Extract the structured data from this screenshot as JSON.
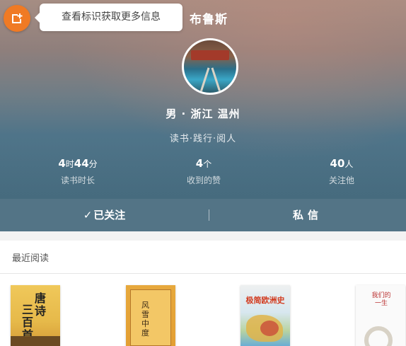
{
  "tooltip": {
    "text": "查看标识获取更多信息"
  },
  "header": {
    "username": "布鲁斯"
  },
  "profile": {
    "gender_location": "男 · 浙江 温州",
    "tagline": "读书·践行·阅人"
  },
  "stats": [
    {
      "value_a": "4",
      "unit_a": "时",
      "value_b": "44",
      "unit_b": "分",
      "label": "读书时长"
    },
    {
      "value_a": "4",
      "unit_a": "个",
      "label": "收到的赞"
    },
    {
      "value_a": "40",
      "unit_a": "人",
      "label": "关注他"
    }
  ],
  "actions": {
    "follow_icon": "✓",
    "follow_label": "已关注",
    "message_label": "私信"
  },
  "recent": {
    "title": "最近阅读",
    "books": [
      {
        "cover_text_a": "唐诗",
        "cover_text_b": "三百首",
        "icon": "book-cover-icon"
      },
      {
        "cover_text_a": "风雪中度",
        "icon": "book-cover-icon"
      },
      {
        "cover_text_a": "极简欧洲史",
        "icon": "book-cover-icon"
      },
      {
        "cover_text_a": "我们的一生",
        "icon": "book-cover-icon"
      }
    ]
  },
  "colors": {
    "accent": "#f07a24",
    "action_bar": "#4a6d7f"
  }
}
